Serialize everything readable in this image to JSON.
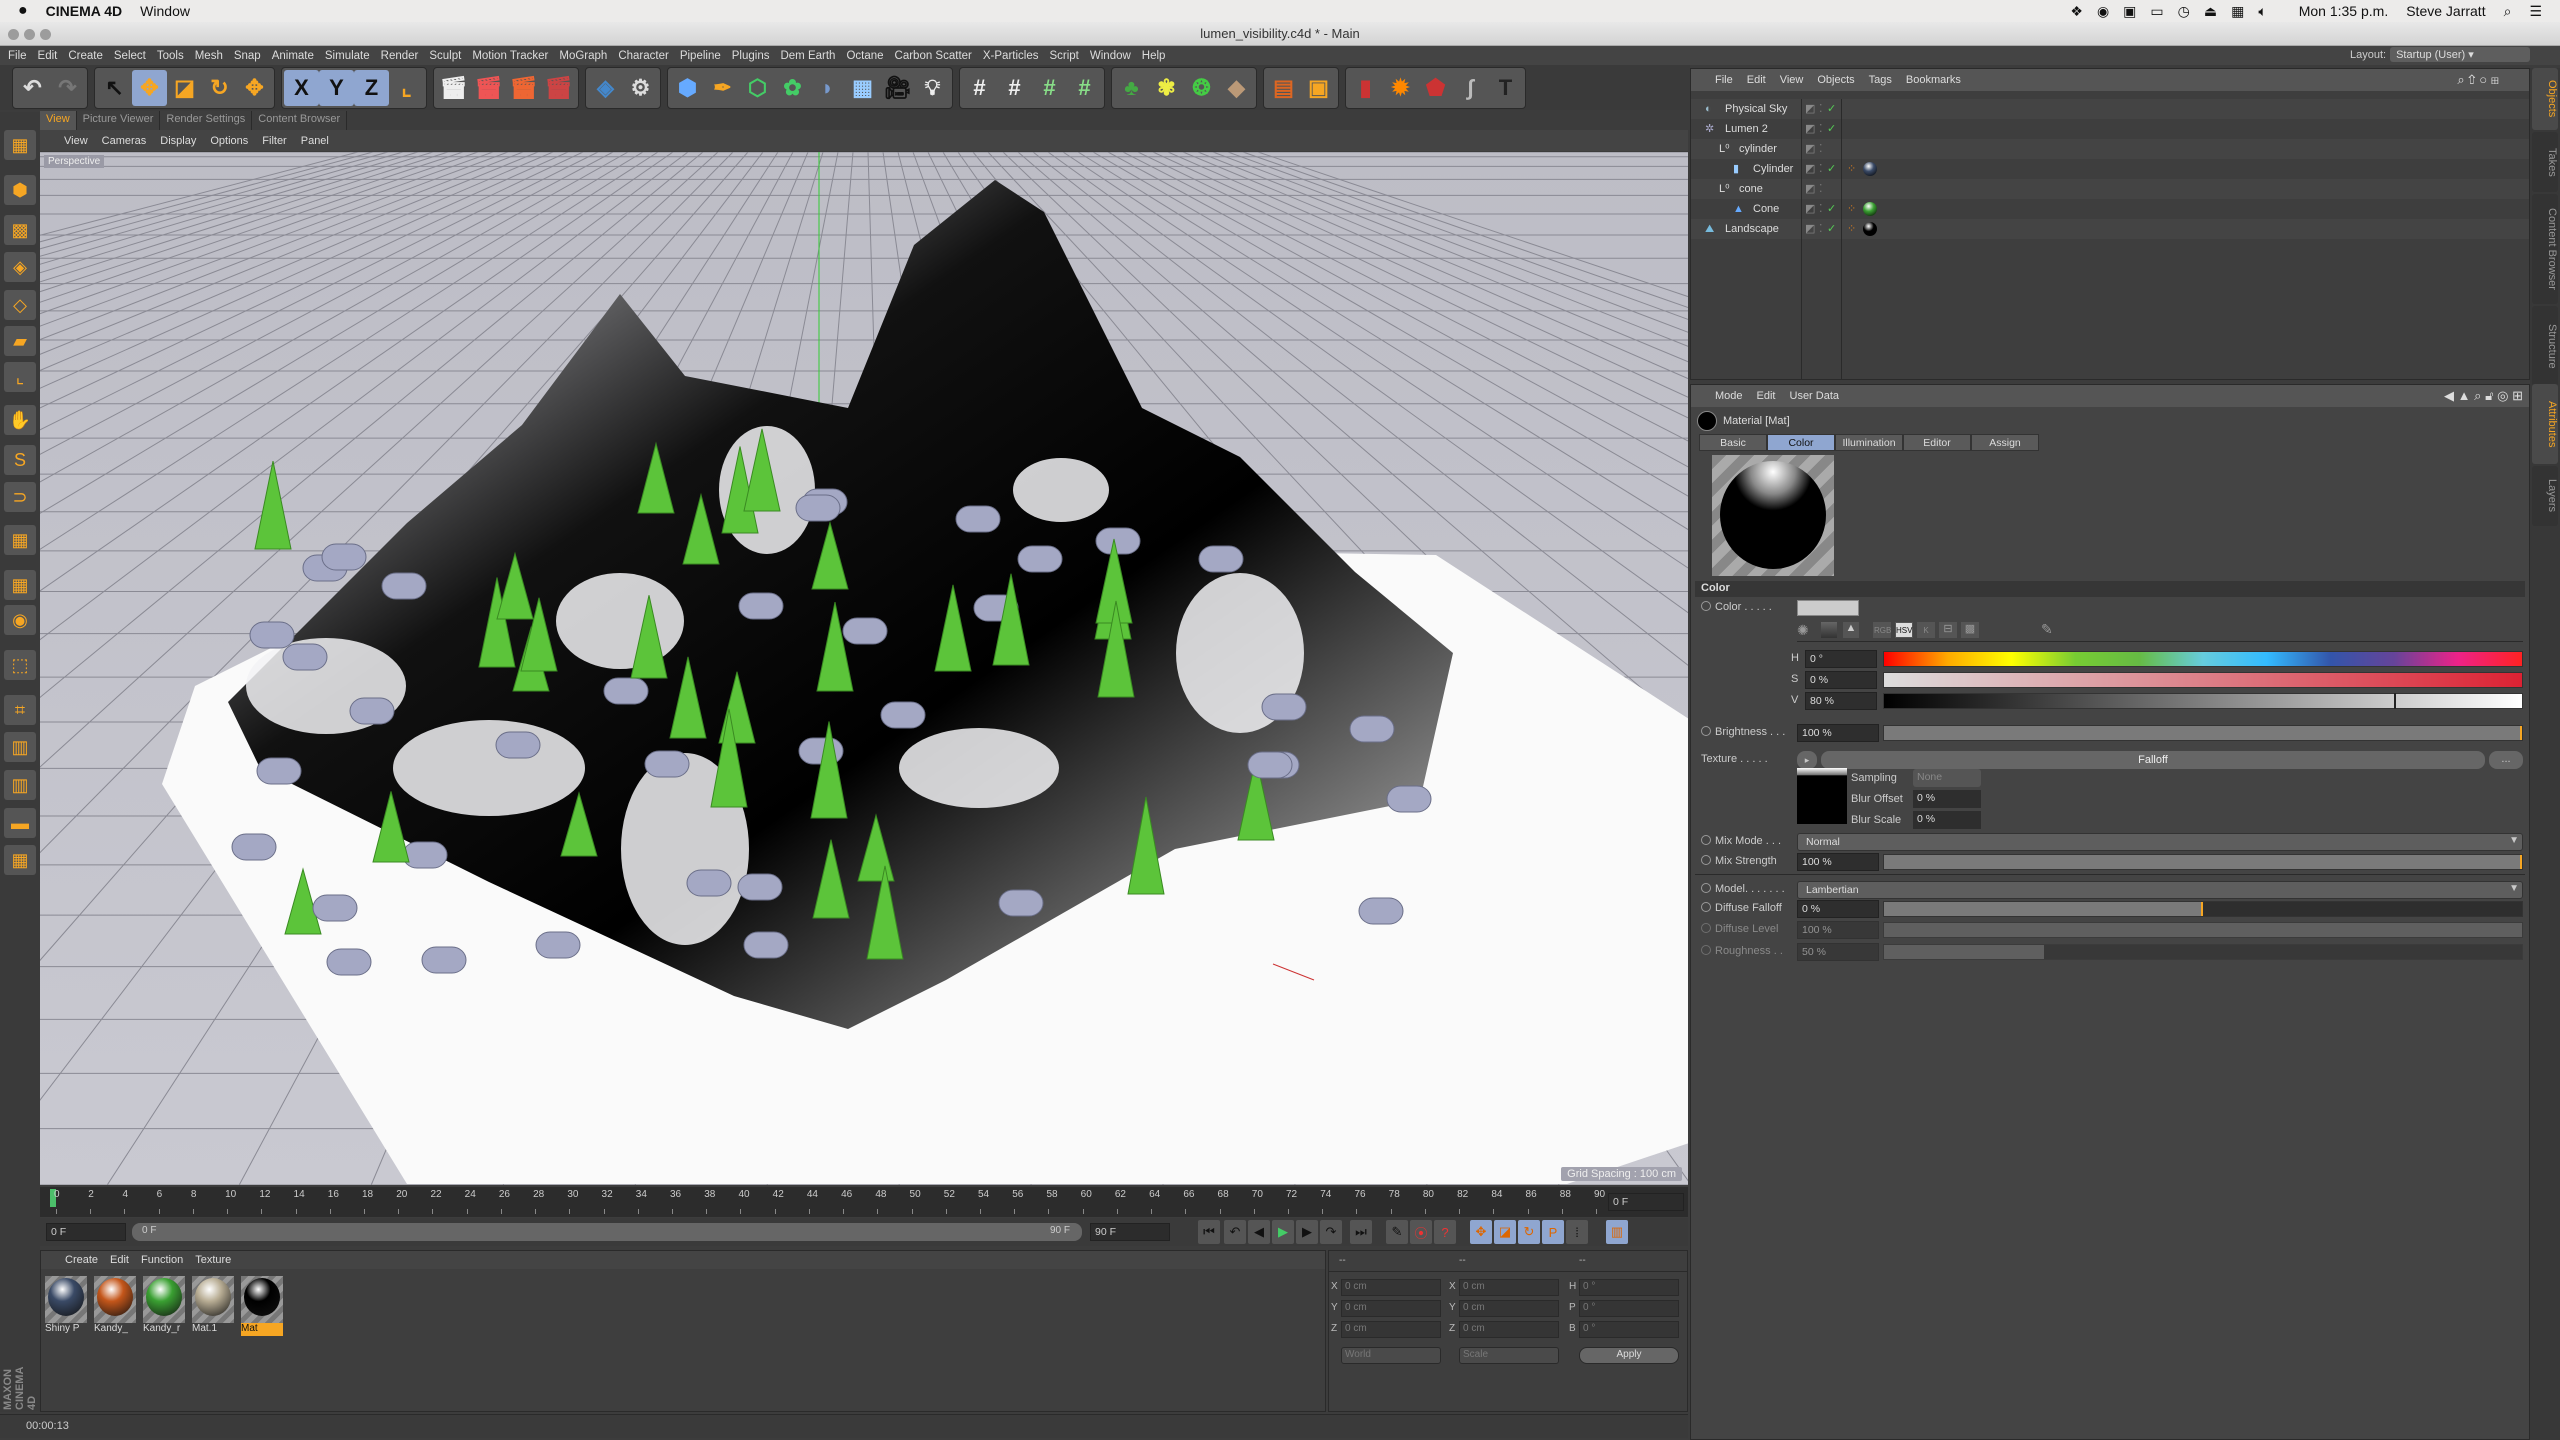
{
  "mac_menubar": {
    "app": "CINEMA 4D",
    "menu": "Window",
    "status_icons": [
      "dropbox-icon",
      "nvidia-icon",
      "lock-icon",
      "display-icon",
      "time-machine-icon",
      "eject-icon",
      "uk-flag-icon",
      "volume-icon"
    ],
    "clock": "Mon 1:35 p.m.",
    "user": "Steve Jarratt"
  },
  "window": {
    "title": "lumen_visibility.c4d * - Main"
  },
  "menu": [
    "File",
    "Edit",
    "Create",
    "Select",
    "Tools",
    "Mesh",
    "Snap",
    "Animate",
    "Simulate",
    "Render",
    "Sculpt",
    "Motion Tracker",
    "MoGraph",
    "Character",
    "Pipeline",
    "Plugins",
    "Dem Earth",
    "Octane",
    "Carbon Scatter",
    "X-Particles",
    "Script",
    "Window",
    "Help"
  ],
  "layout": {
    "label": "Layout:",
    "value": "Startup (User)"
  },
  "toolbar": {
    "groups": [
      [
        "undo",
        "redo"
      ],
      [
        "live-selection",
        "move",
        "scale",
        "rotate",
        "recent-tool"
      ],
      [
        "x-axis",
        "y-axis",
        "z-axis",
        "coordinate-system"
      ],
      [
        "render-view",
        "render-active",
        "render-queue",
        "edit-render-settings"
      ],
      [
        "octane",
        "settings-gear"
      ],
      [
        "cube",
        "pen",
        "subdivision",
        "cloner",
        "deformer",
        "floor",
        "camera",
        "light"
      ],
      [
        "polygon-grid-1",
        "polygon-grid-2",
        "polygon-grid-3",
        "polygon-grid-4"
      ],
      [
        "tree",
        "flower",
        "plant",
        "rock"
      ],
      [
        "brick",
        "frame"
      ],
      [
        "capsule",
        "explosion",
        "shield",
        "spline",
        "hammer"
      ]
    ]
  },
  "left_toolbar": [
    "make-editable",
    "model-mode",
    "texture-mode",
    "points-mode",
    "edges-mode",
    "polygons-mode",
    "axis-mode",
    "tweak-mode",
    "snap-tool",
    "magnet",
    "workplane",
    "locked-workplane",
    "solo",
    "brush",
    "quantize",
    "layout-1",
    "layout-2",
    "layout-3",
    "layout-4"
  ],
  "viewport": {
    "tabs": [
      "View",
      "Picture Viewer",
      "Render Settings",
      "Content Browser"
    ],
    "active_tab": "View",
    "menu": [
      "View",
      "Cameras",
      "Display",
      "Options",
      "Filter",
      "Panel"
    ],
    "camera": "Perspective",
    "grid_spacing": "Grid Spacing : 100 cm"
  },
  "timeline": {
    "ticks": [
      "0",
      "2",
      "4",
      "6",
      "8",
      "10",
      "12",
      "14",
      "16",
      "18",
      "20",
      "22",
      "24",
      "26",
      "28",
      "30",
      "32",
      "34",
      "36",
      "38",
      "40",
      "42",
      "44",
      "46",
      "48",
      "50",
      "52",
      "54",
      "56",
      "58",
      "60",
      "62",
      "64",
      "66",
      "68",
      "70",
      "72",
      "74",
      "76",
      "78",
      "80",
      "82",
      "84",
      "86",
      "88",
      "90"
    ],
    "current_frame": "0 F",
    "start": "0 F",
    "range_start": "0 F",
    "range_end": "90 F",
    "end": "90 F"
  },
  "materials": {
    "menu": [
      "Create",
      "Edit",
      "Function",
      "Texture"
    ],
    "items": [
      {
        "name": "Shiny P",
        "color": "#3a4a66"
      },
      {
        "name": "Kandy_",
        "color": "#c4561a"
      },
      {
        "name": "Kandy_r",
        "color": "#3aa032"
      },
      {
        "name": "Mat.1",
        "color": "#b8ad94"
      },
      {
        "name": "Mat",
        "color": "#000000",
        "selected": true
      }
    ]
  },
  "coordinates": {
    "headers": [
      "--",
      "--",
      "--"
    ],
    "rows": [
      {
        "a": "X",
        "av": "0 cm",
        "b": "X",
        "bv": "0 cm",
        "c": "H",
        "cv": "0 °"
      },
      {
        "a": "Y",
        "av": "0 cm",
        "b": "Y",
        "bv": "0 cm",
        "c": "P",
        "cv": "0 °"
      },
      {
        "a": "Z",
        "av": "0 cm",
        "b": "Z",
        "bv": "0 cm",
        "c": "B",
        "cv": "0 °"
      }
    ],
    "space": "World",
    "mode": "Scale",
    "apply": "Apply"
  },
  "status": {
    "time": "00:00:13"
  },
  "brand": "MAXON CINEMA 4D",
  "object_manager": {
    "menu": [
      "File",
      "Edit",
      "View",
      "Objects",
      "Tags",
      "Bookmarks"
    ],
    "objects": [
      {
        "name": "Physical Sky",
        "icon": "sky-icon",
        "depth": 0
      },
      {
        "name": "Lumen 2",
        "icon": "lumen-icon",
        "depth": 0
      },
      {
        "name": "cylinder",
        "icon": "null-icon",
        "depth": 1
      },
      {
        "name": "Cylinder",
        "icon": "cylinder-icon",
        "depth": 2,
        "material": "#3a4a66"
      },
      {
        "name": "cone",
        "icon": "null-icon",
        "depth": 1
      },
      {
        "name": "Cone",
        "icon": "cone-icon",
        "depth": 2,
        "material": "#3aa032"
      },
      {
        "name": "Landscape",
        "icon": "landscape-icon",
        "depth": 0,
        "material": "#000000"
      }
    ]
  },
  "side_tabs": {
    "top": [
      "Objects",
      "Takes",
      "Content Browser",
      "Structure"
    ],
    "bottom": [
      "Attributes",
      "Layers"
    ]
  },
  "attributes": {
    "menu": [
      "Mode",
      "Edit",
      "User Data"
    ],
    "title": "Material [Mat]",
    "tabs": [
      "Basic",
      "Color",
      "Illumination",
      "Editor",
      "Assign"
    ],
    "active_tab": "Color",
    "section": "Color",
    "color": {
      "label": "Color . . . . .",
      "swatch": "#cccccc",
      "modes": [
        "RGB",
        "HSV",
        "K"
      ],
      "h": "0 °",
      "s": "0 %",
      "v": "80 %",
      "v_fraction": 0.8
    },
    "brightness": {
      "label": "Brightness . . .",
      "value": "100 %",
      "fraction": 1.0
    },
    "texture": {
      "label": "Texture . . . . .",
      "value": "Falloff",
      "more": "...",
      "sampling_label": "Sampling",
      "sampling": "None",
      "blur_offset_label": "Blur Offset",
      "blur_offset": "0 %",
      "blur_scale_label": "Blur Scale",
      "blur_scale": "0 %"
    },
    "mix_mode": {
      "label": "Mix Mode . . .",
      "value": "Normal"
    },
    "mix_strength": {
      "label": "Mix Strength",
      "value": "100 %",
      "fraction": 1.0
    },
    "model": {
      "label": "Model. . . . . . .",
      "value": "Lambertian"
    },
    "diffuse_falloff": {
      "label": "Diffuse Falloff",
      "value": "0 %",
      "fraction": 0.5
    },
    "diffuse_level": {
      "label": "Diffuse Level",
      "value": "100 %",
      "fraction": 1.0
    },
    "roughness": {
      "label": "Roughness . .",
      "value": "50 %",
      "fraction": 0.25
    }
  },
  "colors": {
    "accent": "#f6a623",
    "selected": "#8fa6d0"
  }
}
